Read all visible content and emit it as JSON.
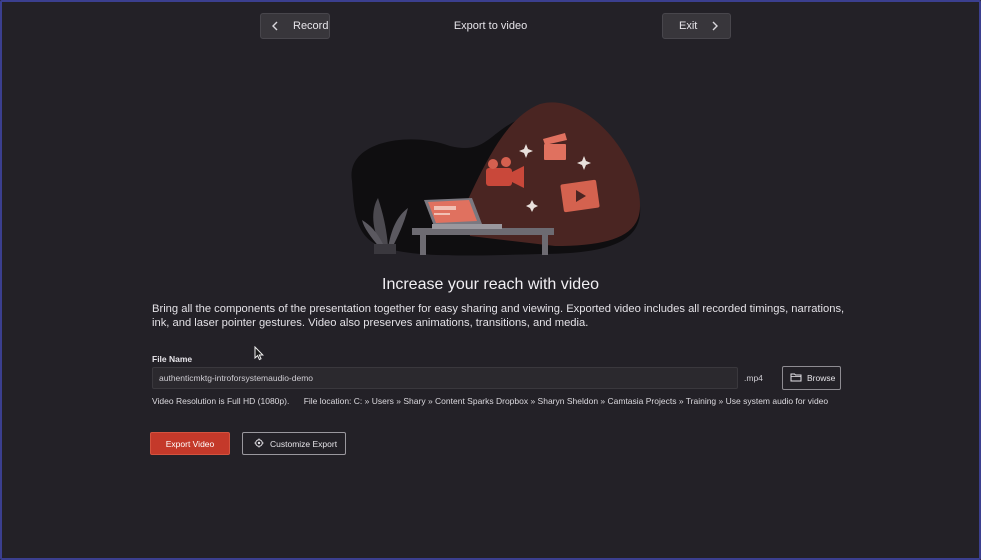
{
  "header": {
    "record_label": "Record",
    "title": "Export to video",
    "exit_label": "Exit"
  },
  "main": {
    "heading": "Increase your reach with video",
    "description": "Bring all the components of the presentation together for easy sharing and viewing. Exported video includes all recorded timings, narrations, ink, and laser pointer gestures. Video also preserves animations, transitions, and media.",
    "file_name_label": "File Name",
    "file_name_value": "authenticmktg-introforsystemaudio-demo",
    "extension": ".mp4",
    "browse_label": "Browse",
    "resolution_text": "Video Resolution is Full HD (1080p).",
    "location_text": "File location: C: » Users » Shary » Content Sparks Dropbox » Sharyn Sheldon » Camtasia Projects » Training » Use system audio for video",
    "export_label": "Export Video",
    "customize_label": "Customize Export"
  },
  "icons": {
    "record": "chevron-left-icon",
    "exit": "chevron-right-icon",
    "browse": "folder-icon",
    "customize": "gear-icon"
  },
  "colors": {
    "background": "#232127",
    "accent": "#c4392a",
    "frame_border": "#3b3f8f"
  }
}
